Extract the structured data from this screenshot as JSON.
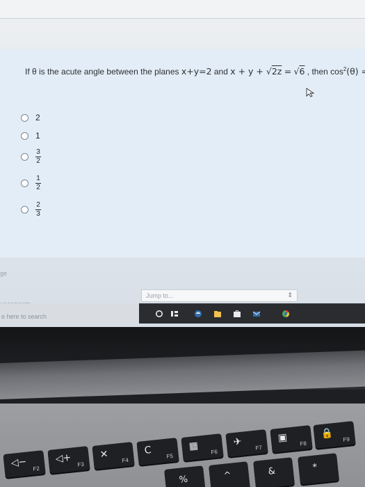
{
  "question": {
    "prefix": "If θ is the acute angle between the planes ",
    "plane1": "x+y=2",
    "middle": " and ",
    "plane2_left": "x + y + ",
    "plane2_sqrt_arg": "2z",
    "plane2_eq": " =",
    "plane2_sqrt_rhs": "6",
    "suffix": ", then cos",
    "power": "2",
    "tail": "(θ) ="
  },
  "options": [
    {
      "type": "text",
      "value": "2"
    },
    {
      "type": "text",
      "value": "1"
    },
    {
      "type": "fraction",
      "num": "3",
      "den": "2"
    },
    {
      "type": "fraction",
      "num": "1",
      "den": "2"
    },
    {
      "type": "fraction",
      "num": "2",
      "den": "3"
    }
  ],
  "sidebar": {
    "page_fragment": "ge",
    "announcements_fragment": "uncements",
    "search_fragment": "e here to search"
  },
  "jump": {
    "label": "Jump to...",
    "arrows": "⇕"
  },
  "keyboard": {
    "keys": [
      {
        "icon": "◁−",
        "label": "F2"
      },
      {
        "icon": "◁+",
        "label": "F3"
      },
      {
        "icon": "✕",
        "label": "F4"
      },
      {
        "icon": "C",
        "label": "F5"
      },
      {
        "icon": "▦",
        "label": "F6"
      },
      {
        "icon": "✈",
        "label": "F7"
      },
      {
        "icon": "▣",
        "label": "F8"
      },
      {
        "icon": "🔒",
        "label": "F9"
      }
    ],
    "lower_keys": [
      {
        "txt": "%"
      },
      {
        "txt": "^"
      },
      {
        "txt": "&"
      },
      {
        "txt": "*"
      }
    ]
  },
  "colors": {
    "accent": "#2f6fb0",
    "taskbar": "#2a2c30"
  }
}
